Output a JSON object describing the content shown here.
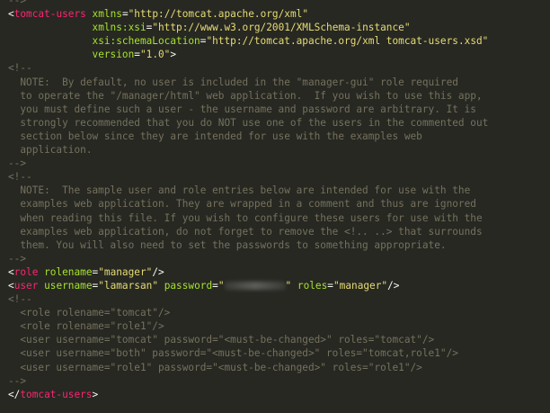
{
  "editor": {
    "colors": {
      "background": "#272822",
      "tag": "#f92672",
      "attribute": "#a6e22e",
      "string": "#e6db74",
      "comment": "#75715e",
      "text": "#f8f8f2"
    },
    "lines": [
      {
        "indent": "",
        "tokens": [
          {
            "t": "comment",
            "v": "-->"
          }
        ]
      },
      {
        "indent": "",
        "tokens": [
          {
            "t": "punct",
            "v": "<"
          },
          {
            "t": "tag",
            "v": "tomcat-users"
          },
          {
            "t": "punct",
            "v": " "
          },
          {
            "t": "attr",
            "v": "xmlns"
          },
          {
            "t": "eq",
            "v": "="
          },
          {
            "t": "str",
            "v": "\"http://tomcat.apache.org/xml\""
          }
        ]
      },
      {
        "indent": "              ",
        "tokens": [
          {
            "t": "attr",
            "v": "xmlns:xsi"
          },
          {
            "t": "eq",
            "v": "="
          },
          {
            "t": "str",
            "v": "\"http://www.w3.org/2001/XMLSchema-instance\""
          }
        ]
      },
      {
        "indent": "              ",
        "tokens": [
          {
            "t": "attr",
            "v": "xsi:schemaLocation"
          },
          {
            "t": "eq",
            "v": "="
          },
          {
            "t": "str",
            "v": "\"http://tomcat.apache.org/xml tomcat-users.xsd\""
          }
        ]
      },
      {
        "indent": "              ",
        "tokens": [
          {
            "t": "attr",
            "v": "version"
          },
          {
            "t": "eq",
            "v": "="
          },
          {
            "t": "str",
            "v": "\"1.0\""
          },
          {
            "t": "punct",
            "v": ">"
          }
        ]
      },
      {
        "indent": "",
        "tokens": [
          {
            "t": "comment",
            "v": "<!--"
          }
        ]
      },
      {
        "indent": "  ",
        "tokens": [
          {
            "t": "comment",
            "v": "NOTE:  By default, no user is included in the \"manager-gui\" role required"
          }
        ]
      },
      {
        "indent": "  ",
        "tokens": [
          {
            "t": "comment",
            "v": "to operate the \"/manager/html\" web application.  If you wish to use this app,"
          }
        ]
      },
      {
        "indent": "  ",
        "tokens": [
          {
            "t": "comment",
            "v": "you must define such a user - the username and password are arbitrary. It is"
          }
        ]
      },
      {
        "indent": "  ",
        "tokens": [
          {
            "t": "comment",
            "v": "strongly recommended that you do NOT use one of the users in the commented out"
          }
        ]
      },
      {
        "indent": "  ",
        "tokens": [
          {
            "t": "comment",
            "v": "section below since they are intended for use with the examples web"
          }
        ]
      },
      {
        "indent": "  ",
        "tokens": [
          {
            "t": "comment",
            "v": "application."
          }
        ]
      },
      {
        "indent": "",
        "tokens": [
          {
            "t": "comment",
            "v": "-->"
          }
        ]
      },
      {
        "indent": "",
        "tokens": [
          {
            "t": "comment",
            "v": "<!--"
          }
        ]
      },
      {
        "indent": "  ",
        "tokens": [
          {
            "t": "comment",
            "v": "NOTE:  The sample user and role entries below are intended for use with the"
          }
        ]
      },
      {
        "indent": "  ",
        "tokens": [
          {
            "t": "comment",
            "v": "examples web application. They are wrapped in a comment and thus are ignored"
          }
        ]
      },
      {
        "indent": "  ",
        "tokens": [
          {
            "t": "comment",
            "v": "when reading this file. If you wish to configure these users for use with the"
          }
        ]
      },
      {
        "indent": "  ",
        "tokens": [
          {
            "t": "comment",
            "v": "examples web application, do not forget to remove the <!.. ..> that surrounds"
          }
        ]
      },
      {
        "indent": "  ",
        "tokens": [
          {
            "t": "comment",
            "v": "them. You will also need to set the passwords to something appropriate."
          }
        ]
      },
      {
        "indent": "",
        "tokens": [
          {
            "t": "comment",
            "v": "-->"
          }
        ]
      },
      {
        "indent": "",
        "tokens": [
          {
            "t": "punct",
            "v": "<"
          },
          {
            "t": "tag",
            "v": "role"
          },
          {
            "t": "punct",
            "v": " "
          },
          {
            "t": "attr",
            "v": "rolename"
          },
          {
            "t": "eq",
            "v": "="
          },
          {
            "t": "str",
            "v": "\"manager\""
          },
          {
            "t": "punct",
            "v": "/>"
          }
        ]
      },
      {
        "indent": "",
        "tokens": [
          {
            "t": "punct",
            "v": "<"
          },
          {
            "t": "tag",
            "v": "user"
          },
          {
            "t": "punct",
            "v": " "
          },
          {
            "t": "attr",
            "v": "username"
          },
          {
            "t": "eq",
            "v": "="
          },
          {
            "t": "str",
            "v": "\"lamarsan\""
          },
          {
            "t": "punct",
            "v": " "
          },
          {
            "t": "attr",
            "v": "password"
          },
          {
            "t": "eq",
            "v": "="
          },
          {
            "t": "str",
            "v": "\""
          },
          {
            "t": "redacted",
            "v": ""
          },
          {
            "t": "str",
            "v": "\""
          },
          {
            "t": "punct",
            "v": " "
          },
          {
            "t": "attr",
            "v": "roles"
          },
          {
            "t": "eq",
            "v": "="
          },
          {
            "t": "str",
            "v": "\"manager\""
          },
          {
            "t": "punct",
            "v": "/>"
          }
        ]
      },
      {
        "indent": "",
        "tokens": [
          {
            "t": "comment",
            "v": "<!--"
          }
        ]
      },
      {
        "indent": "  ",
        "tokens": [
          {
            "t": "comment",
            "v": "<role rolename=\"tomcat\"/>"
          }
        ]
      },
      {
        "indent": "  ",
        "tokens": [
          {
            "t": "comment",
            "v": "<role rolename=\"role1\"/>"
          }
        ]
      },
      {
        "indent": "  ",
        "tokens": [
          {
            "t": "comment",
            "v": "<user username=\"tomcat\" password=\"<must-be-changed>\" roles=\"tomcat\"/>"
          }
        ]
      },
      {
        "indent": "  ",
        "tokens": [
          {
            "t": "comment",
            "v": "<user username=\"both\" password=\"<must-be-changed>\" roles=\"tomcat,role1\"/>"
          }
        ]
      },
      {
        "indent": "  ",
        "tokens": [
          {
            "t": "comment",
            "v": "<user username=\"role1\" password=\"<must-be-changed>\" roles=\"role1\"/>"
          }
        ]
      },
      {
        "indent": "",
        "tokens": [
          {
            "t": "comment",
            "v": "-->"
          }
        ]
      },
      {
        "indent": "",
        "tokens": [
          {
            "t": "punct",
            "v": "</"
          },
          {
            "t": "tag",
            "v": "tomcat-users"
          },
          {
            "t": "punct",
            "v": ">"
          }
        ]
      },
      {
        "indent": "",
        "tokens": []
      }
    ]
  }
}
